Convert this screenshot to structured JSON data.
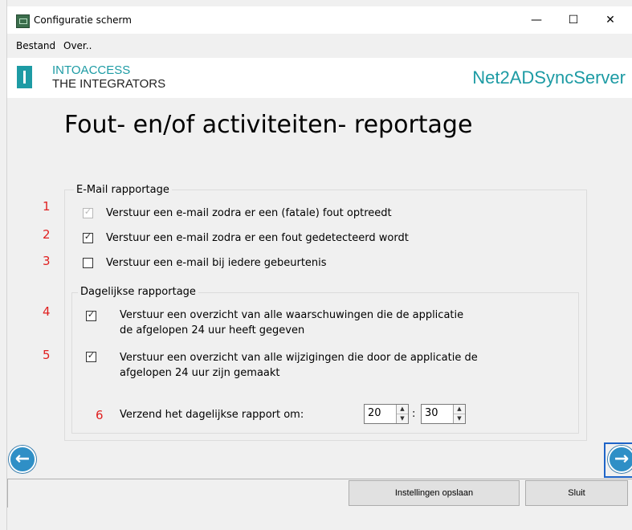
{
  "window": {
    "title": "Configuratie scherm",
    "controls": {
      "minimize": "—",
      "maximize": "☐",
      "close": "✕"
    }
  },
  "menu": {
    "items": [
      "Bestand",
      "Over.."
    ]
  },
  "branding": {
    "logo_line1": "INTOACCESS",
    "logo_line2": "THE INTEGRATORS",
    "app_name": "Net2ADSyncServer",
    "accent_color": "#1d9ba4"
  },
  "page": {
    "title": "Fout- en/of activiteiten- reportage"
  },
  "email_group": {
    "legend": "E-Mail rapportage",
    "options": [
      {
        "number": "1",
        "label": "Verstuur een e-mail zodra er een (fatale) fout optreedt",
        "checked": true,
        "enabled": false
      },
      {
        "number": "2",
        "label": "Verstuur een e-mail zodra er een fout gedetecteerd wordt",
        "checked": true,
        "enabled": true
      },
      {
        "number": "3",
        "label": "Verstuur een e-mail bij iedere gebeurtenis",
        "checked": false,
        "enabled": true
      }
    ]
  },
  "daily_group": {
    "legend": "Dagelijkse rapportage",
    "options": [
      {
        "number": "4",
        "line1": "Verstuur een overzicht van alle waarschuwingen die de applicatie",
        "line2": "de afgelopen 24 uur heeft gegeven",
        "checked": true
      },
      {
        "number": "5",
        "line1": "Verstuur een overzicht van alle wijzigingen die door de applicatie de",
        "line2": "afgelopen 24 uur zijn gemaakt",
        "checked": true
      }
    ],
    "send_time": {
      "number": "6",
      "label": "Verzend het dagelijkse rapport om:",
      "hour": "20",
      "separator": ":",
      "minute": "30"
    }
  },
  "navigation": {
    "back_icon": "arrow-left-icon",
    "next_icon": "arrow-right-icon"
  },
  "buttons": {
    "save": "Instellingen opslaan",
    "close": "Sluit"
  }
}
